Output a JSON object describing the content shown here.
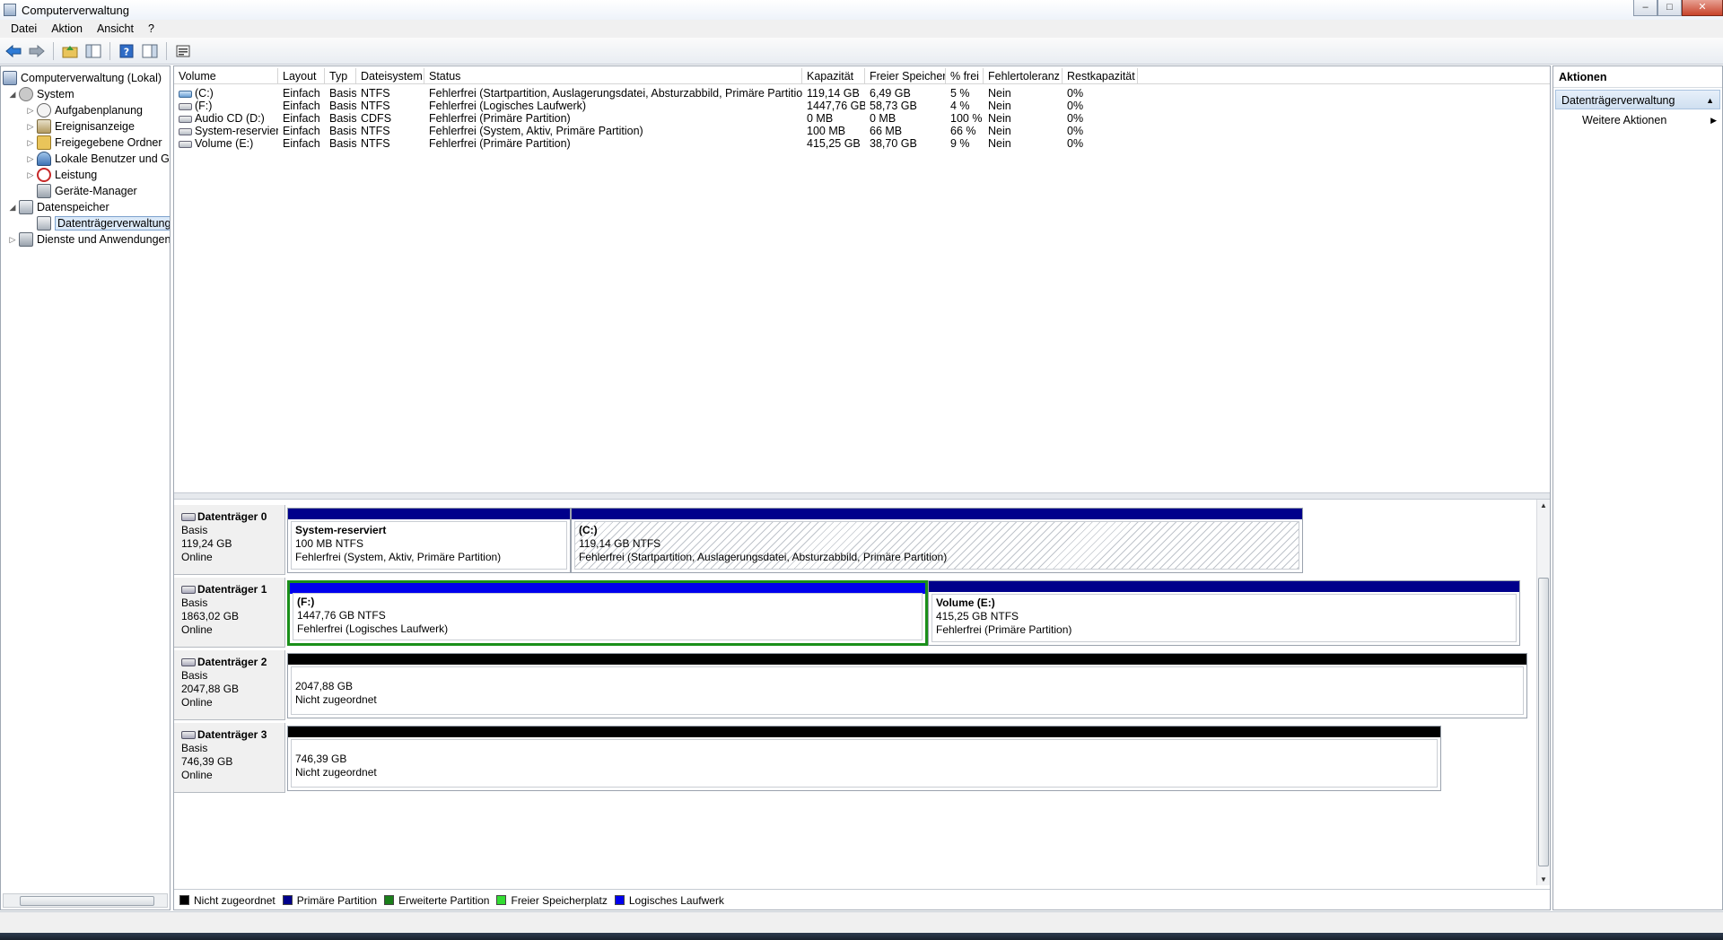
{
  "window": {
    "title": "Computerverwaltung"
  },
  "menu": [
    "Datei",
    "Aktion",
    "Ansicht",
    "?"
  ],
  "tree": {
    "root": "Computerverwaltung (Lokal)",
    "system": "System",
    "system_items": [
      "Aufgabenplanung",
      "Ereignisanzeige",
      "Freigegebene Ordner",
      "Lokale Benutzer und Gr",
      "Leistung",
      "Geräte-Manager"
    ],
    "storage": "Datenspeicher",
    "storage_items": [
      "Datenträgerverwaltung"
    ],
    "services": "Dienste und Anwendungen"
  },
  "volumes": {
    "columns": [
      "Volume",
      "Layout",
      "Typ",
      "Dateisystem",
      "Status",
      "Kapazität",
      "Freier Speicher",
      "% frei",
      "Fehlertoleranz",
      "Restkapazität"
    ],
    "rows": [
      [
        "(C:)",
        "Einfach",
        "Basis",
        "NTFS",
        "Fehlerfrei (Startpartition, Auslagerungsdatei, Absturzabbild, Primäre Partition)",
        "119,14 GB",
        "6,49 GB",
        "5 %",
        "Nein",
        "0%"
      ],
      [
        "(F:)",
        "Einfach",
        "Basis",
        "NTFS",
        "Fehlerfrei (Logisches Laufwerk)",
        "1447,76 GB",
        "58,73 GB",
        "4 %",
        "Nein",
        "0%"
      ],
      [
        "Audio CD (D:)",
        "Einfach",
        "Basis",
        "CDFS",
        "Fehlerfrei (Primäre Partition)",
        "0 MB",
        "0 MB",
        "100 %",
        "Nein",
        "0%"
      ],
      [
        "System-reserviert",
        "Einfach",
        "Basis",
        "NTFS",
        "Fehlerfrei (System, Aktiv, Primäre Partition)",
        "100 MB",
        "66 MB",
        "66 %",
        "Nein",
        "0%"
      ],
      [
        "Volume (E:)",
        "Einfach",
        "Basis",
        "NTFS",
        "Fehlerfrei (Primäre Partition)",
        "415,25 GB",
        "38,70 GB",
        "9 %",
        "Nein",
        "0%"
      ]
    ]
  },
  "disks": [
    {
      "name": "Datenträger 0",
      "type": "Basis",
      "size": "119,24 GB",
      "state": "Online",
      "partitions": [
        {
          "name": "System-reserviert",
          "size": "100 MB NTFS",
          "status": "Fehlerfrei (System, Aktiv, Primäre Partition)",
          "bar_color": "#00008b"
        },
        {
          "name": "(C:)",
          "size": "119,14 GB NTFS",
          "status": "Fehlerfrei (Startpartition, Auslagerungsdatei, Absturzabbild, Primäre Partition)",
          "bar_color": "#00008b"
        }
      ]
    },
    {
      "name": "Datenträger 1",
      "type": "Basis",
      "size": "1863,02 GB",
      "state": "Online",
      "partitions": [
        {
          "name": "(F:)",
          "size": "1447,76 GB NTFS",
          "status": "Fehlerfrei (Logisches Laufwerk)",
          "bar_color": "#0000ee"
        },
        {
          "name": "Volume  (E:)",
          "size": "415,25 GB NTFS",
          "status": "Fehlerfrei (Primäre Partition)",
          "bar_color": "#00008b"
        }
      ]
    },
    {
      "name": "Datenträger 2",
      "type": "Basis",
      "size": "2047,88 GB",
      "state": "Online",
      "partitions": [
        {
          "size": "2047,88 GB",
          "status": "Nicht zugeordnet",
          "bar_color": "#000000"
        }
      ]
    },
    {
      "name": "Datenträger 3",
      "type": "Basis",
      "size": "746,39 GB",
      "state": "Online",
      "partitions": [
        {
          "size": "746,39 GB",
          "status": "Nicht zugeordnet",
          "bar_color": "#000000"
        }
      ]
    }
  ],
  "legend": [
    {
      "label": "Nicht zugeordnet",
      "color": "#000000"
    },
    {
      "label": "Primäre Partition",
      "color": "#00008b"
    },
    {
      "label": "Erweiterte Partition",
      "color": "#1a7f1a"
    },
    {
      "label": "Freier Speicherplatz",
      "color": "#33dd33"
    },
    {
      "label": "Logisches Laufwerk",
      "color": "#0000ee"
    }
  ],
  "actions": {
    "header": "Aktionen",
    "section": "Datenträgerverwaltung",
    "more": "Weitere Aktionen"
  },
  "icons": {
    "back": "back-arrow-icon",
    "forward": "forward-arrow-icon",
    "help": "help-icon"
  }
}
